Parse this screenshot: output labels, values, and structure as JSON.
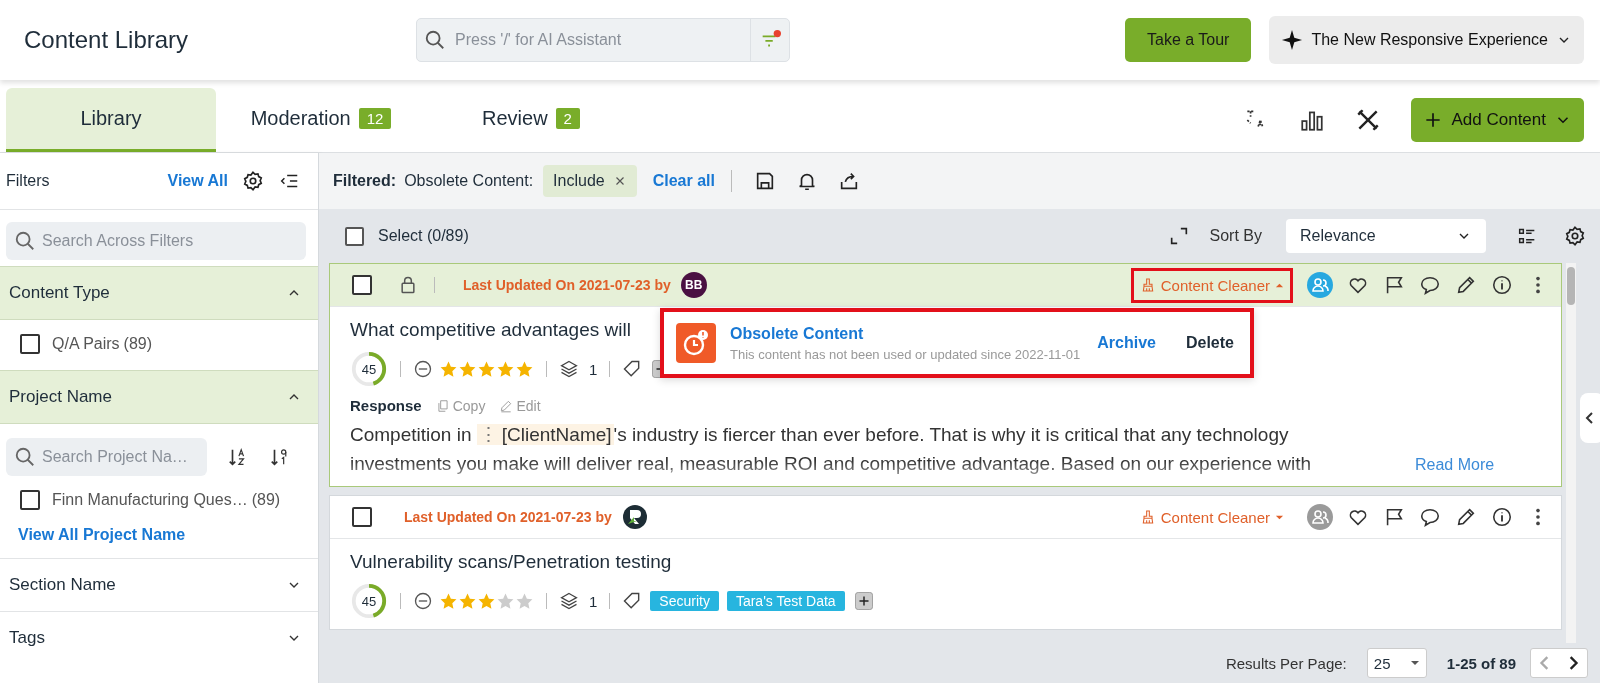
{
  "header": {
    "title": "Content Library",
    "search": {
      "placeholder": "Press '/' for AI Assistant",
      "filter_alert": true
    },
    "tour_button": "Take a Tour",
    "experience_button": "The New Responsive Experience"
  },
  "tabs": [
    {
      "label": "Library",
      "selected": true
    },
    {
      "label": "Moderation",
      "badge": "12",
      "selected": false
    },
    {
      "label": "Review",
      "badge": "2",
      "selected": false
    }
  ],
  "add_button": "Add Content",
  "sidebar": {
    "title": "Filters",
    "view_all": "View All",
    "search": {
      "placeholder": "Search Across Filters"
    },
    "sections": [
      {
        "title": "Content Type",
        "expanded": true,
        "options": [
          {
            "label": "Q/A Pairs",
            "count": "(89)",
            "checked": false
          }
        ]
      },
      {
        "title": "Project Name",
        "expanded": true,
        "search": {
          "placeholder": "Search Project Na…"
        },
        "options": [
          {
            "label": "Finn Manufacturing Ques…",
            "count": "(89)",
            "checked": false
          }
        ],
        "link": "View All Project Name"
      },
      {
        "title": "Section Name",
        "expanded": false
      },
      {
        "title": "Tags",
        "expanded": false
      }
    ]
  },
  "filter_bar": {
    "label": "Filtered:",
    "filter": "Obsolete Content:",
    "chip": "Include",
    "clear": "Clear all"
  },
  "toolbar": {
    "select_all_checked": false,
    "select": "Select (0/89)",
    "sort_label": "Sort By",
    "sort_value": "Relevance"
  },
  "cards": [
    {
      "selected": true,
      "checked": false,
      "locked": true,
      "updated": "Last Updated On 2021-07-23 by",
      "avatar": {
        "kind": "initials",
        "text": "BB",
        "color": "#4a1042"
      },
      "cleaner": "Content Cleaner",
      "cleaner_open": true,
      "assigned": true,
      "title": "What competitive advantages will",
      "score": "45",
      "level": 0.45,
      "stars": 5,
      "versions": "1",
      "response": {
        "label": "Response",
        "copy": "Copy",
        "edit": "Edit",
        "before": "Competition in ",
        "token_mark": "⋮",
        "token": "[ClientName]",
        "after": "'s industry is fiercer than ever before. That is why it is critical that any technology investments you make will deliver real, measurable ROI and competitive advantage. Based on our experience with",
        "more": "Read More"
      },
      "popup": {
        "title": "Obsolete Content",
        "text": "This content has not been used or updated since 2022-11-01",
        "archive": "Archive",
        "delete": "Delete",
        "highlighted": true
      }
    },
    {
      "selected": false,
      "checked": false,
      "locked": false,
      "updated": "Last Updated On 2021-07-23 by",
      "avatar": {
        "kind": "logo"
      },
      "cleaner": "Content Cleaner",
      "cleaner_open": false,
      "assigned": false,
      "title": "Vulnerability scans/Penetration testing",
      "score": "45",
      "level": 0.45,
      "stars": 3,
      "versions": "1",
      "tags": [
        "Security",
        "Tara's Test Data"
      ]
    }
  ],
  "footer": {
    "per_page_label": "Results Per Page:",
    "per_page": "25",
    "range": "1-25 of 89"
  }
}
